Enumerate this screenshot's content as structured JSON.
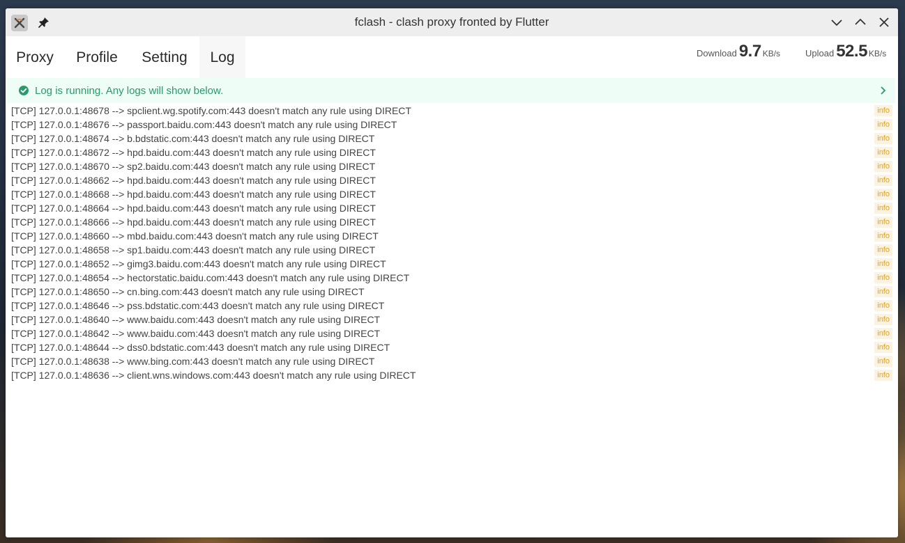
{
  "window": {
    "title": "fclash - clash proxy fronted by Flutter"
  },
  "tabs": [
    {
      "label": "Proxy",
      "active": false
    },
    {
      "label": "Profile",
      "active": false
    },
    {
      "label": "Setting",
      "active": false
    },
    {
      "label": "Log",
      "active": true
    }
  ],
  "traffic": {
    "download_label": "Download",
    "download_value": "9.7",
    "download_unit": "KB/s",
    "upload_label": "Upload",
    "upload_value": "52.5",
    "upload_unit": "KB/s"
  },
  "banner": {
    "text": "Log is running. Any logs will show below.",
    "icon": "check-circle-icon",
    "color": "#2a9a6a"
  },
  "logs": [
    {
      "message": "[TCP] 127.0.0.1:48678 --> spclient.wg.spotify.com:443 doesn't match any rule using DIRECT",
      "level": "info"
    },
    {
      "message": "[TCP] 127.0.0.1:48676 --> passport.baidu.com:443 doesn't match any rule using DIRECT",
      "level": "info"
    },
    {
      "message": "[TCP] 127.0.0.1:48674 --> b.bdstatic.com:443 doesn't match any rule using DIRECT",
      "level": "info"
    },
    {
      "message": "[TCP] 127.0.0.1:48672 --> hpd.baidu.com:443 doesn't match any rule using DIRECT",
      "level": "info"
    },
    {
      "message": "[TCP] 127.0.0.1:48670 --> sp2.baidu.com:443 doesn't match any rule using DIRECT",
      "level": "info"
    },
    {
      "message": "[TCP] 127.0.0.1:48662 --> hpd.baidu.com:443 doesn't match any rule using DIRECT",
      "level": "info"
    },
    {
      "message": "[TCP] 127.0.0.1:48668 --> hpd.baidu.com:443 doesn't match any rule using DIRECT",
      "level": "info"
    },
    {
      "message": "[TCP] 127.0.0.1:48664 --> hpd.baidu.com:443 doesn't match any rule using DIRECT",
      "level": "info"
    },
    {
      "message": "[TCP] 127.0.0.1:48666 --> hpd.baidu.com:443 doesn't match any rule using DIRECT",
      "level": "info"
    },
    {
      "message": "[TCP] 127.0.0.1:48660 --> mbd.baidu.com:443 doesn't match any rule using DIRECT",
      "level": "info"
    },
    {
      "message": "[TCP] 127.0.0.1:48658 --> sp1.baidu.com:443 doesn't match any rule using DIRECT",
      "level": "info"
    },
    {
      "message": "[TCP] 127.0.0.1:48652 --> gimg3.baidu.com:443 doesn't match any rule using DIRECT",
      "level": "info"
    },
    {
      "message": "[TCP] 127.0.0.1:48654 --> hectorstatic.baidu.com:443 doesn't match any rule using DIRECT",
      "level": "info"
    },
    {
      "message": "[TCP] 127.0.0.1:48650 --> cn.bing.com:443 doesn't match any rule using DIRECT",
      "level": "info"
    },
    {
      "message": "[TCP] 127.0.0.1:48646 --> pss.bdstatic.com:443 doesn't match any rule using DIRECT",
      "level": "info"
    },
    {
      "message": "[TCP] 127.0.0.1:48640 --> www.baidu.com:443 doesn't match any rule using DIRECT",
      "level": "info"
    },
    {
      "message": "[TCP] 127.0.0.1:48642 --> www.baidu.com:443 doesn't match any rule using DIRECT",
      "level": "info"
    },
    {
      "message": "[TCP] 127.0.0.1:48644 --> dss0.bdstatic.com:443 doesn't match any rule using DIRECT",
      "level": "info"
    },
    {
      "message": "[TCP] 127.0.0.1:48638 --> www.bing.com:443 doesn't match any rule using DIRECT",
      "level": "info"
    },
    {
      "message": "[TCP] 127.0.0.1:48636 --> client.wns.windows.com:443 doesn't match any rule using DIRECT",
      "level": "info"
    }
  ]
}
